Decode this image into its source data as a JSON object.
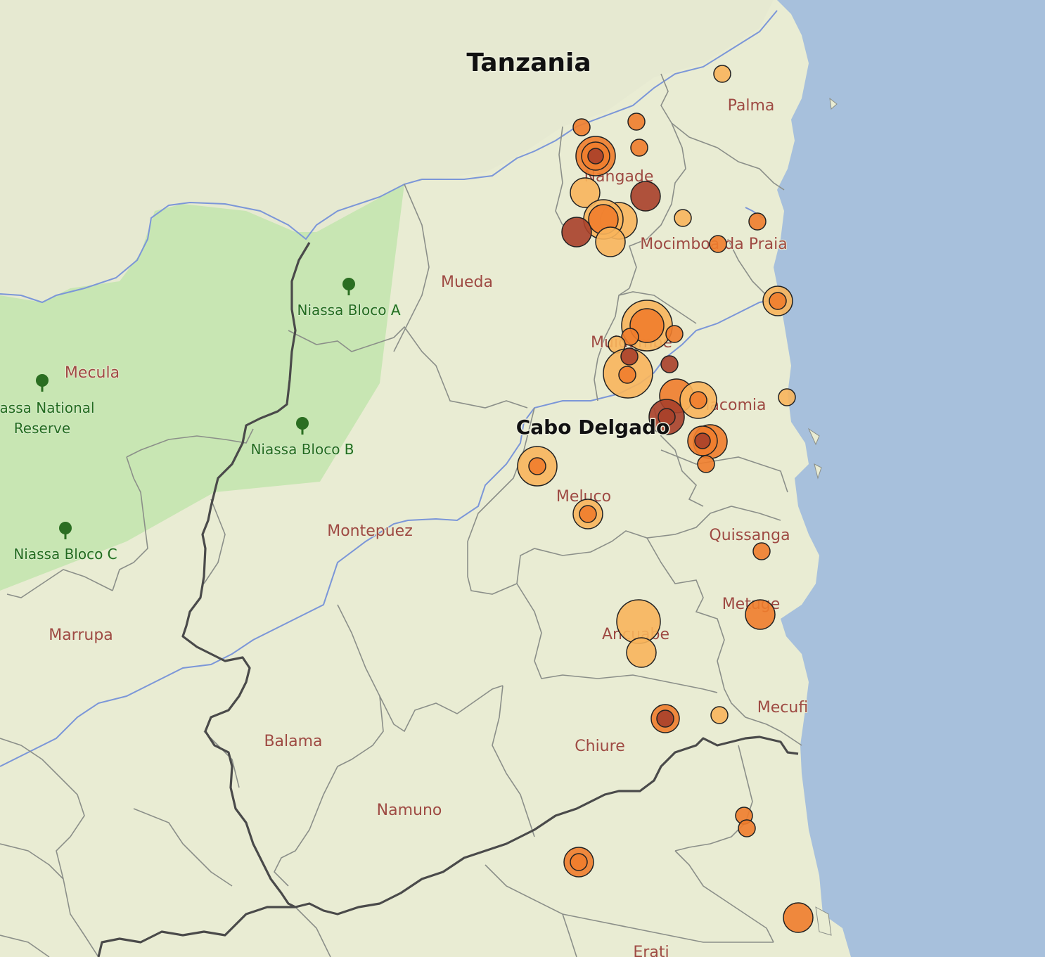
{
  "map": {
    "country_label": "Tanzania",
    "province_label": "Cabo Delgado",
    "district_labels": [
      "Palma",
      "Nangade",
      "Mocimboa da Praia",
      "Mueda",
      "Muidumbe",
      "Macomia",
      "Mecula",
      "Meluco",
      "Montepuez",
      "Quissanga",
      "Metuge",
      "Marrupa",
      "Ancuabe",
      "Mecufi",
      "Balama",
      "Chiure",
      "Namuno",
      "Erati"
    ],
    "park_labels": [
      "Niassa Bloco A",
      "Niassa National Reserve",
      "Niassa Bloco B",
      "Niassa Bloco C"
    ],
    "colors": {
      "land": "#e9ecd3",
      "sea": "#a7c0dc",
      "park": "#c8e6b3",
      "river": "#7b96d8",
      "district_border": "#8b8f89",
      "national_border": "#4a4a4a",
      "severity_low": "#f8b55c",
      "severity_mid": "#ef7d2c",
      "severity_high": "#a9402a"
    },
    "legend": null
  }
}
